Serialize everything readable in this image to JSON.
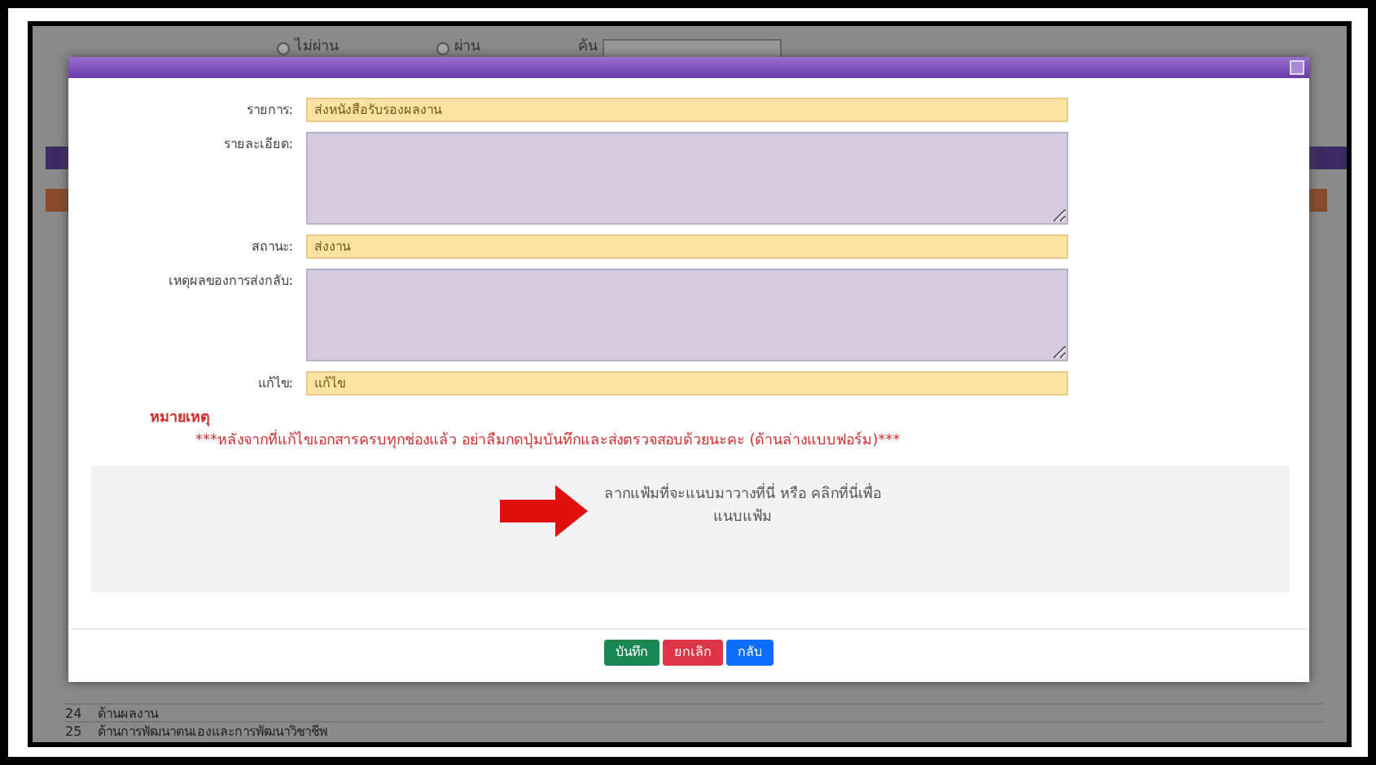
{
  "backdrop": {
    "radios": [
      {
        "label": "ไม่ผ่าน",
        "selected": false
      },
      {
        "label": "ผ่าน",
        "selected": false
      }
    ],
    "search": {
      "label": "ค้น"
    },
    "rows": [
      {
        "number": "24",
        "text": "ด้านผลงาน"
      },
      {
        "number": "25",
        "text": "ด้านการพัฒนาตนเองและการพัฒนาวิชาชีพ"
      }
    ]
  },
  "modal": {
    "fields": [
      {
        "label": "รายการ:",
        "kind": "input",
        "value": "ส่งหนังสือรับรองผลงาน"
      },
      {
        "label": "รายละเอียด:",
        "kind": "textarea"
      },
      {
        "label": "สถานะ:",
        "kind": "input",
        "value": "ส่งงาน"
      },
      {
        "label": "เหตุผลของการส่งกลับ:",
        "kind": "textarea"
      },
      {
        "label": "แก้ไข:",
        "kind": "input",
        "value": "แก้ไข"
      }
    ],
    "note_title": "หมายเหตุ",
    "note": "***หลังจากที่แก้ไขเอกสารครบทุกช่องแล้ว อย่าลืมกดปุ่มบันทึกและส่งตรวจสอบด้วยนะคะ (ด้านล่างแบบฟอร์ม)***",
    "dropzone": "ลากแฟ้มที่จะแนบมาวางที่นี่ หรือ คลิกที่นี่เพื่อ แนบแฟ้ม",
    "buttons": [
      {
        "label": "บันทึก",
        "kind": "success"
      },
      {
        "label": "ยกเลิก",
        "kind": "danger"
      },
      {
        "label": "กลับ",
        "kind": "primary"
      }
    ]
  }
}
